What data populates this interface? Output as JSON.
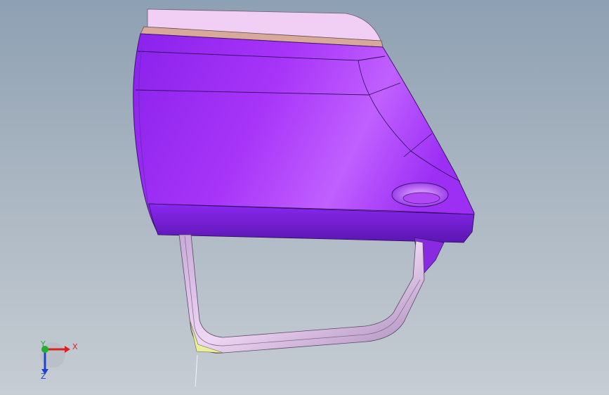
{
  "viewport": {
    "background_top": "#8ea0b3",
    "background_bottom": "#c6cdd3",
    "model_color": "#9a2df5",
    "model_highlight": "#c879ff",
    "model_shadow": "#5c1fb8",
    "top_cap_color": "#f1cff4"
  },
  "triad": {
    "x_label": "X",
    "y_label": "Y",
    "z_label": "Z",
    "x_color": "#e02020",
    "y_color": "#20b030",
    "z_color": "#2040d0"
  }
}
